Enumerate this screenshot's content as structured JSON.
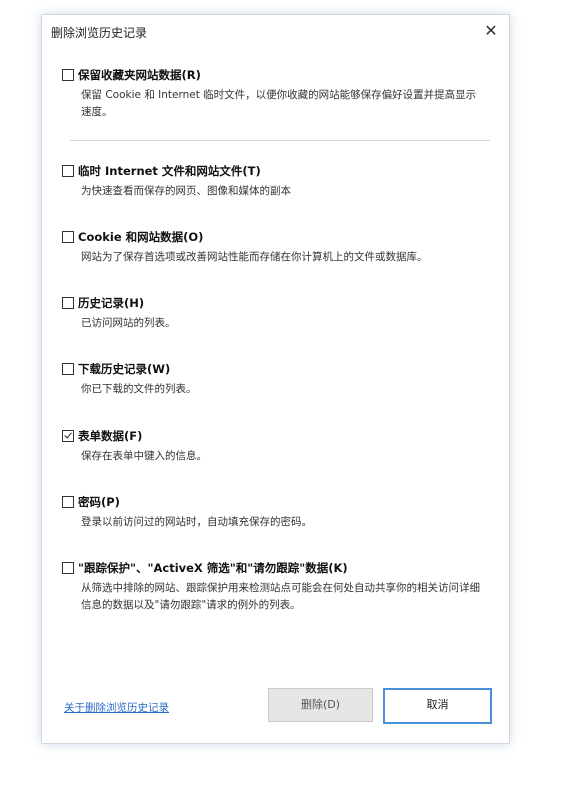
{
  "dialog": {
    "title": "删除浏览历史记录",
    "close_glyph": "✕"
  },
  "options": [
    {
      "label": "保留收藏夹网站数据(R)",
      "checked": false,
      "description": "保留 Cookie 和 Internet 临时文件，以便你收藏的网站能够保存偏好设置并提高显示速度。"
    },
    {
      "label": "临时 Internet 文件和网站文件(T)",
      "checked": false,
      "description": "为快速查看而保存的网页、图像和媒体的副本"
    },
    {
      "label": "Cookie 和网站数据(O)",
      "checked": false,
      "description": "网站为了保存首选项或改善网站性能而存储在你计算机上的文件或数据库。"
    },
    {
      "label": "历史记录(H)",
      "checked": false,
      "description": "已访问网站的列表。"
    },
    {
      "label": "下载历史记录(W)",
      "checked": false,
      "description": "你已下载的文件的列表。"
    },
    {
      "label": "表单数据(F)",
      "checked": true,
      "description": "保存在表单中键入的信息。"
    },
    {
      "label": "密码(P)",
      "checked": false,
      "description": "登录以前访问过的网站时，自动填充保存的密码。"
    },
    {
      "label": "\"跟踪保护\"、\"ActiveX 筛选\"和\"请勿跟踪\"数据(K)",
      "checked": false,
      "description": "从筛选中排除的网站、跟踪保护用来检测站点可能会在何处自动共享你的相关访问详细信息的数据以及\"请勿跟踪\"请求的例外的列表。"
    }
  ],
  "footer": {
    "help_link": "关于删除浏览历史记录",
    "delete_button": "删除(D)",
    "cancel_button": "取消"
  },
  "colors": {
    "link": "#2c6cc7",
    "primary_button_border": "#4a90d9"
  }
}
